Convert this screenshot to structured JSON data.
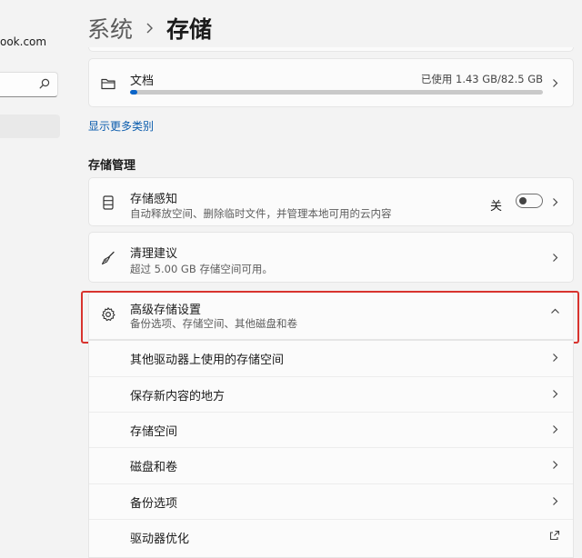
{
  "sidebar": {
    "account_email": "ook.com"
  },
  "breadcrumb": {
    "parent": "系统",
    "current": "存储"
  },
  "documents": {
    "title": "文档",
    "usage": "已使用 1.43 GB/82.5 GB",
    "used_fraction": 0.017
  },
  "show_more_link": "显示更多类别",
  "storage_management": {
    "header": "存储管理",
    "sense": {
      "title": "存储感知",
      "desc": "自动释放空间、删除临时文件，并管理本地可用的云内容",
      "toggle_label": "关",
      "toggle_on": false
    },
    "cleanup": {
      "title": "清理建议",
      "desc": "超过 5.00 GB 存储空间可用。"
    },
    "advanced": {
      "title": "高级存储设置",
      "desc": "备份选项、存储空间、其他磁盘和卷",
      "expanded": true
    },
    "sub_items": [
      {
        "label": "其他驱动器上使用的存储空间"
      },
      {
        "label": "保存新内容的地方"
      },
      {
        "label": "存储空间"
      },
      {
        "label": "磁盘和卷"
      },
      {
        "label": "备份选项"
      },
      {
        "label": "驱动器优化"
      }
    ]
  },
  "colors": {
    "accent": "#0a64c8",
    "highlight": "#d8332e"
  }
}
